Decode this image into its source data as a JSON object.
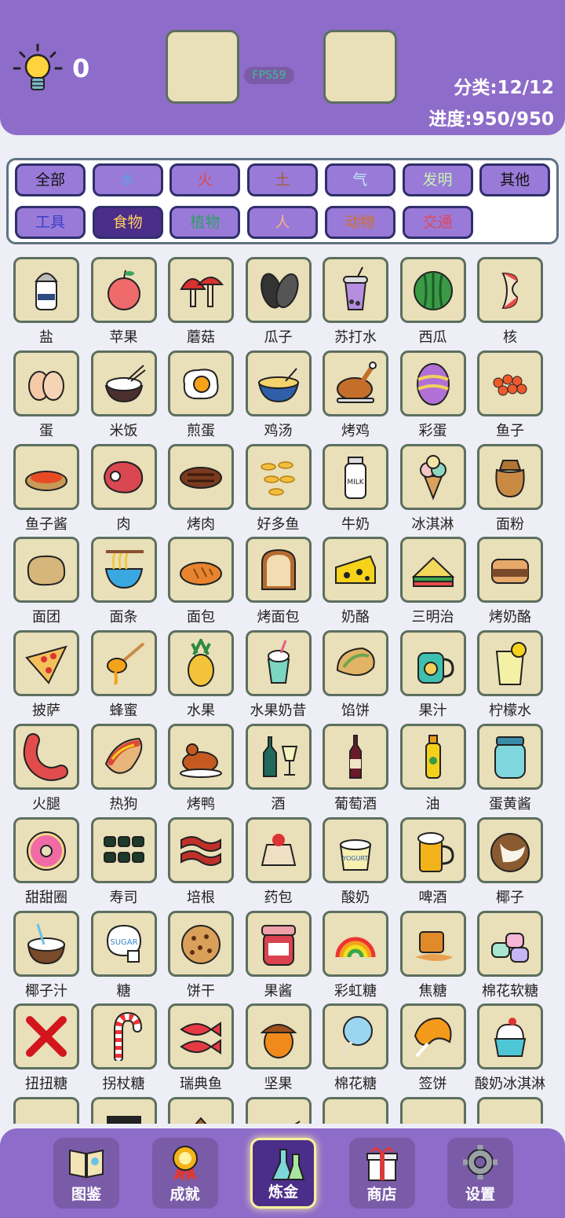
{
  "header": {
    "hint_count": "0",
    "fps": "FPS59",
    "category_stat": "分类:12/12",
    "progress_stat": "进度:950/950"
  },
  "filters": [
    {
      "label": "全部",
      "color": "#111111"
    },
    {
      "label": "水",
      "color": "#5aa0e8"
    },
    {
      "label": "火",
      "color": "#e04848"
    },
    {
      "label": "土",
      "color": "#a0603a"
    },
    {
      "label": "气",
      "color": "#bfe6f2"
    },
    {
      "label": "发明",
      "color": "#c9f2b0"
    },
    {
      "label": "其他",
      "color": "#111111"
    },
    {
      "label": "工具",
      "color": "#3a40c8"
    },
    {
      "label": "食物",
      "color": "#ffd060",
      "active": true
    },
    {
      "label": "植物",
      "color": "#2f9d6a"
    },
    {
      "label": "人",
      "color": "#f5b08a"
    },
    {
      "label": "动物",
      "color": "#d0702a"
    },
    {
      "label": "交通",
      "color": "#e04858"
    }
  ],
  "items": [
    {
      "name": "盐",
      "icon": "salt-icon"
    },
    {
      "name": "苹果",
      "icon": "apple-icon"
    },
    {
      "name": "蘑菇",
      "icon": "mushroom-icon"
    },
    {
      "name": "瓜子",
      "icon": "sunflower-seed-icon"
    },
    {
      "name": "苏打水",
      "icon": "soda-icon"
    },
    {
      "name": "西瓜",
      "icon": "watermelon-icon"
    },
    {
      "name": "核",
      "icon": "apple-core-icon"
    },
    {
      "name": "蛋",
      "icon": "egg-icon"
    },
    {
      "name": "米饭",
      "icon": "rice-icon"
    },
    {
      "name": "煎蛋",
      "icon": "fried-egg-icon"
    },
    {
      "name": "鸡汤",
      "icon": "chicken-soup-icon"
    },
    {
      "name": "烤鸡",
      "icon": "roast-chicken-icon"
    },
    {
      "name": "彩蛋",
      "icon": "easter-egg-icon"
    },
    {
      "name": "鱼子",
      "icon": "roe-icon"
    },
    {
      "name": "鱼子酱",
      "icon": "caviar-icon"
    },
    {
      "name": "肉",
      "icon": "meat-icon"
    },
    {
      "name": "烤肉",
      "icon": "grilled-meat-icon"
    },
    {
      "name": "好多鱼",
      "icon": "fish-crackers-icon"
    },
    {
      "name": "牛奶",
      "icon": "milk-icon"
    },
    {
      "name": "冰淇淋",
      "icon": "ice-cream-icon"
    },
    {
      "name": "面粉",
      "icon": "flour-icon"
    },
    {
      "name": "面团",
      "icon": "dough-icon"
    },
    {
      "name": "面条",
      "icon": "noodles-icon"
    },
    {
      "name": "面包",
      "icon": "bread-icon"
    },
    {
      "name": "烤面包",
      "icon": "toast-icon"
    },
    {
      "name": "奶酪",
      "icon": "cheese-icon"
    },
    {
      "name": "三明治",
      "icon": "sandwich-icon"
    },
    {
      "name": "烤奶酪",
      "icon": "grilled-cheese-icon"
    },
    {
      "name": "披萨",
      "icon": "pizza-icon"
    },
    {
      "name": "蜂蜜",
      "icon": "honey-icon"
    },
    {
      "name": "水果",
      "icon": "pineapple-icon"
    },
    {
      "name": "水果奶昔",
      "icon": "smoothie-icon"
    },
    {
      "name": "馅饼",
      "icon": "pie-icon"
    },
    {
      "name": "果汁",
      "icon": "juice-icon"
    },
    {
      "name": "柠檬水",
      "icon": "lemonade-icon"
    },
    {
      "name": "火腿",
      "icon": "sausage-icon"
    },
    {
      "name": "热狗",
      "icon": "hotdog-icon"
    },
    {
      "name": "烤鸭",
      "icon": "roast-duck-icon"
    },
    {
      "name": "酒",
      "icon": "liquor-icon"
    },
    {
      "name": "葡萄酒",
      "icon": "wine-icon"
    },
    {
      "name": "油",
      "icon": "oil-icon"
    },
    {
      "name": "蛋黄酱",
      "icon": "mayonnaise-icon"
    },
    {
      "name": "甜甜圈",
      "icon": "donut-icon"
    },
    {
      "name": "寿司",
      "icon": "sushi-icon"
    },
    {
      "name": "培根",
      "icon": "bacon-icon"
    },
    {
      "name": "药包",
      "icon": "medicine-pack-icon"
    },
    {
      "name": "酸奶",
      "icon": "yogurt-icon"
    },
    {
      "name": "啤酒",
      "icon": "beer-icon"
    },
    {
      "name": "椰子",
      "icon": "coconut-icon"
    },
    {
      "name": "椰子汁",
      "icon": "coconut-juice-icon"
    },
    {
      "name": "糖",
      "icon": "sugar-icon"
    },
    {
      "name": "饼干",
      "icon": "cookie-icon"
    },
    {
      "name": "果酱",
      "icon": "jam-icon"
    },
    {
      "name": "彩虹糖",
      "icon": "rainbow-candy-icon"
    },
    {
      "name": "焦糖",
      "icon": "caramel-icon"
    },
    {
      "name": "棉花软糖",
      "icon": "marshmallow-icon"
    },
    {
      "name": "扭扭糖",
      "icon": "twisted-candy-icon"
    },
    {
      "name": "拐杖糖",
      "icon": "candy-cane-icon"
    },
    {
      "name": "瑞典鱼",
      "icon": "swedish-fish-icon"
    },
    {
      "name": "坚果",
      "icon": "acorn-icon"
    },
    {
      "name": "棉花糖",
      "icon": "cotton-candy-icon"
    },
    {
      "name": "签饼",
      "icon": "fortune-cookie-icon"
    },
    {
      "name": "酸奶冰淇淋",
      "icon": "frozen-yogurt-icon"
    },
    {
      "name": "",
      "icon": "gem-candy-icon"
    },
    {
      "name": "",
      "icon": "pop-rocks-icon"
    },
    {
      "name": "",
      "icon": "gingerbread-house-icon"
    },
    {
      "name": "",
      "icon": "dish-icon"
    },
    {
      "name": "",
      "icon": "gum-icon"
    },
    {
      "name": "",
      "icon": "burrito-icon"
    },
    {
      "name": "",
      "icon": "taco-icon"
    }
  ],
  "nav": [
    {
      "label": "图鉴",
      "icon": "book-icon"
    },
    {
      "label": "成就",
      "icon": "medal-icon"
    },
    {
      "label": "炼金",
      "icon": "flask-icon",
      "active": true
    },
    {
      "label": "商店",
      "icon": "gift-icon"
    },
    {
      "label": "设置",
      "icon": "gear-icon"
    }
  ]
}
